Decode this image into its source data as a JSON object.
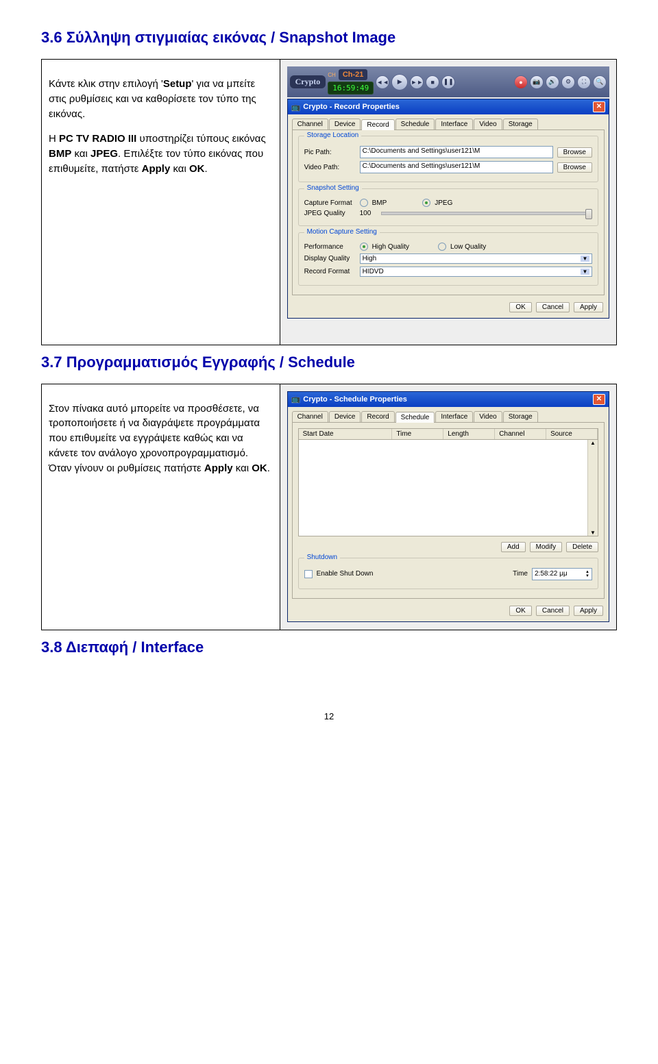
{
  "headings": {
    "h36": "3.6 Σύλληψη στιγμιαίας εικόνας / Snapshot Image",
    "h37": "3.7 Προγραμματισμός Εγγραφής / Schedule",
    "h38": "3.8 Διεπαφή / Interface"
  },
  "text36": {
    "p1a": "Κάντε κλικ στην επιλογή ",
    "p1b": "Setup",
    "p1c": " για να μπείτε στις ρυθμίσεις και να καθορίσετε τον τύπο της εικόνας.",
    "p2a": "Η ",
    "p2b": "PC TV RADIO III",
    "p2c": " υποστηρίζει τύπους εικόνας ",
    "p2d": "BMP",
    "p2e": " και ",
    "p2f": "JPEG",
    "p2g": ". Επιλέξτε τον τύπο εικόνας που επιθυμείτε, πατήστε ",
    "p2h": "Apply",
    "p2i": " και ",
    "p2j": "OK",
    "p2k": "."
  },
  "text37": {
    "p1a": "Στον πίνακα αυτό μπορείτε να προσθέσετε, να τροποποιήσετε ή να διαγράψετε προγράμματα που επιθυμείτε να εγγράψετε καθώς και να κάνετε τον ανάλογο χρονοπρογραμματισμό. Όταν γίνουν οι ρυθμίσεις πατήστε ",
    "p1b": "Apply",
    "p1c": " και ",
    "p1d": "OK",
    "p1e": "."
  },
  "player": {
    "brand": "Crypto",
    "clock": "16:59:49",
    "ch_lbl": "CH",
    "channel": "Ch-21"
  },
  "record_dlg": {
    "title": "Crypto - Record Properties",
    "tabs": [
      "Channel",
      "Device",
      "Record",
      "Schedule",
      "Interface",
      "Video",
      "Storage"
    ],
    "active_tab": 2,
    "storage_group": "Storage Location",
    "pic_path_lbl": "Pic Path:",
    "pic_path_val": "C:\\Documents and Settings\\user121\\M",
    "vid_path_lbl": "Video Path:",
    "vid_path_val": "C:\\Documents and Settings\\user121\\M",
    "browse": "Browse",
    "snapshot_group": "Snapshot Setting",
    "capfmt_lbl": "Capture Format",
    "bmp": "BMP",
    "jpeg": "JPEG",
    "jpegq_lbl": "JPEG Quality",
    "jpegq_val": "100",
    "motion_group": "Motion Capture Setting",
    "perf_lbl": "Performance",
    "highq": "High Quality",
    "lowq": "Low Quality",
    "dispq_lbl": "Display Quality",
    "dispq_val": "High",
    "recfmt_lbl": "Record Format",
    "recfmt_val": "HIDVD",
    "ok": "OK",
    "cancel": "Cancel",
    "apply": "Apply"
  },
  "sched_dlg": {
    "title": "Crypto - Schedule Properties",
    "tabs": [
      "Channel",
      "Device",
      "Record",
      "Schedule",
      "Interface",
      "Video",
      "Storage"
    ],
    "active_tab": 3,
    "cols": [
      "Start Date",
      "Time",
      "Length",
      "Channel",
      "Source"
    ],
    "add": "Add",
    "modify": "Modify",
    "delete": "Delete",
    "shutdown_group": "Shutdown",
    "enable_sd": "Enable Shut Down",
    "time_lbl": "Time",
    "time_val": "2:58:22 μμ",
    "ok": "OK",
    "cancel": "Cancel",
    "apply": "Apply"
  },
  "page_number": "12"
}
